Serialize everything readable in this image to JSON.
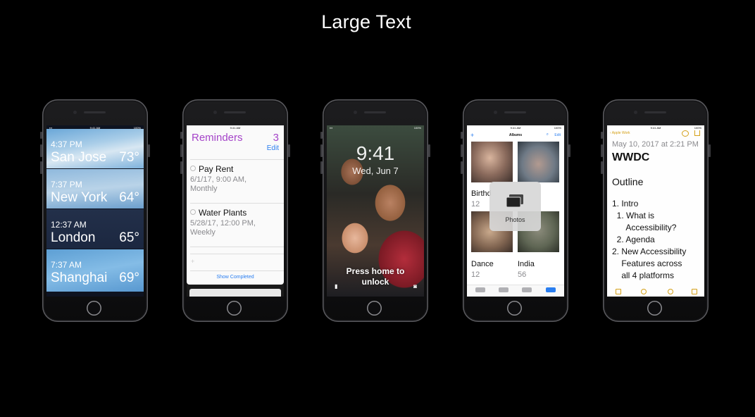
{
  "slide": {
    "title": "Large Text"
  },
  "status": {
    "time": "9:41 AM",
    "battery": "100%"
  },
  "weather": {
    "rows": [
      {
        "time": "4:37 PM",
        "city": "San Jose",
        "temp": "73°"
      },
      {
        "time": "7:37 PM",
        "city": "New York",
        "temp": "64°"
      },
      {
        "time": "12:37 AM",
        "city": "London",
        "temp": "65°"
      },
      {
        "time": "7:37 AM",
        "city": "Shanghai",
        "temp": "69°"
      }
    ]
  },
  "reminders": {
    "title": "Reminders",
    "count": "3",
    "edit_label": "Edit",
    "items": [
      {
        "title": "Pay Rent",
        "detail1": "6/1/17, 9:00 AM,",
        "detail2": "Monthly"
      },
      {
        "title": "Water Plants",
        "detail1": "5/28/17, 12:00 PM,",
        "detail2": "Weekly"
      }
    ],
    "add_label": "+",
    "show_completed_label": "Show Completed"
  },
  "lockscreen": {
    "time": "9:41",
    "date": "Wed, Jun 7",
    "prompt_line1": "Press home to",
    "prompt_line2": "unlock"
  },
  "photos": {
    "nav_title": "Albums",
    "add_label": "+",
    "edit_label": "Edit",
    "albums": [
      {
        "name": "Birthd",
        "count": "12"
      },
      {
        "name": "Dance",
        "count": "12"
      },
      {
        "name": "India",
        "count": "56"
      }
    ],
    "hud_label": "Photos"
  },
  "notes": {
    "back_label": "Apple Work",
    "date": "May 10, 2017 at 2:21 PM",
    "title": "WWDC",
    "heading": "Outline",
    "lines": [
      "1. Intro",
      "  1. What is",
      "      Accessibility?",
      "  2. Agenda",
      "2. New Accessibility",
      "    Features across",
      "    all 4 platforms"
    ]
  }
}
